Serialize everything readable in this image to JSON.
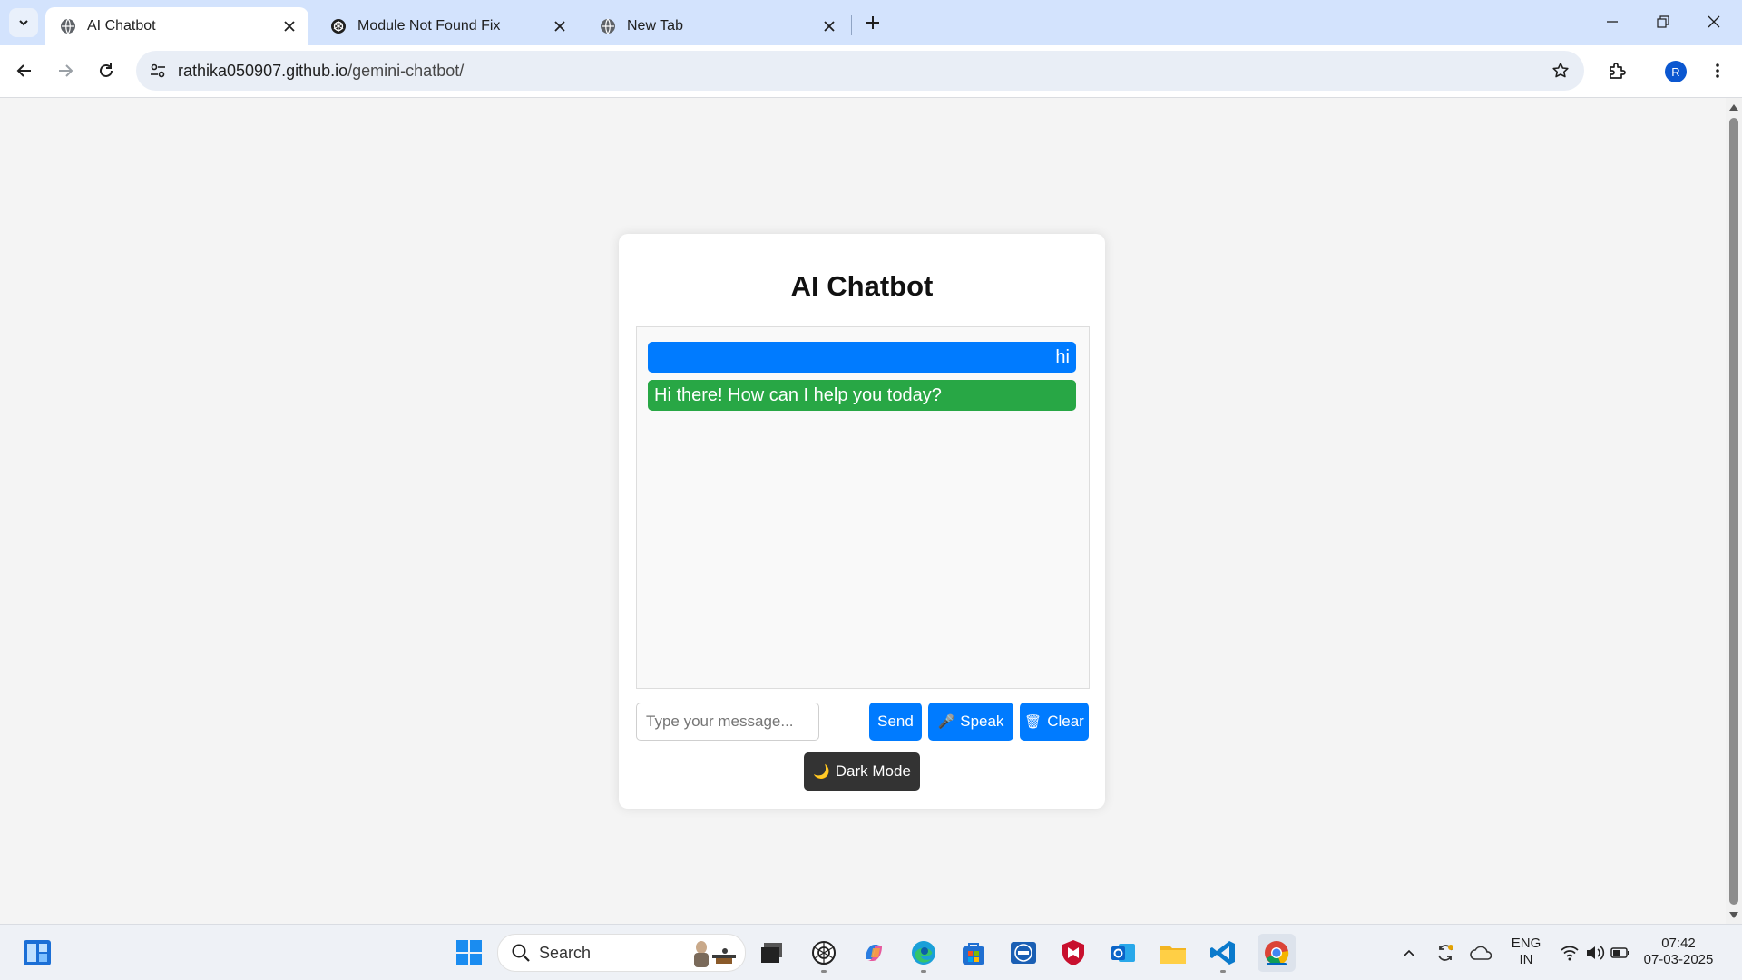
{
  "browser": {
    "tabs": [
      {
        "title": "AI Chatbot",
        "active": true,
        "icon": "globe-icon"
      },
      {
        "title": "Module Not Found Fix",
        "active": false,
        "icon": "chatgpt-icon"
      },
      {
        "title": "New Tab",
        "active": false,
        "icon": "globe-icon"
      }
    ],
    "url_host": "rathika050907.github.io",
    "url_path": "/gemini-chatbot/",
    "profile_initial": "R"
  },
  "page": {
    "title": "AI Chatbot",
    "messages": [
      {
        "role": "user",
        "text": "hi",
        "color": "#007bff"
      },
      {
        "role": "bot",
        "text": "Hi there! How can I help you today?",
        "color": "#28a745"
      }
    ],
    "input_placeholder": "Type your message...",
    "buttons": {
      "send": "Send",
      "speak": "Speak",
      "speak_icon": "🎤",
      "clear": "Clear",
      "clear_icon": "🗑",
      "dark_mode": "Dark Mode",
      "dark_mode_icon": "🌙"
    },
    "accent_color": "#007bff"
  },
  "taskbar": {
    "search_label": "Search",
    "language": "ENG",
    "region": "IN",
    "time": "07:42",
    "date": "07-03-2025"
  }
}
